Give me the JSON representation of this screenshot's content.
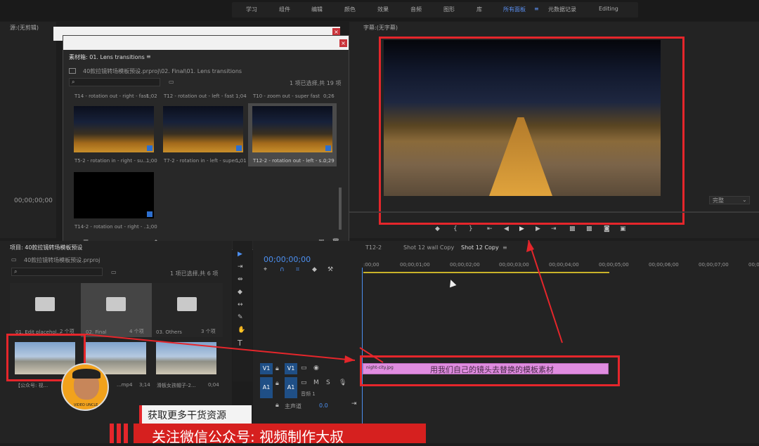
{
  "topbar": {
    "tabs": [
      "学习",
      "组件",
      "编辑",
      "颜色",
      "效果",
      "音频",
      "图形",
      "库",
      "所有面板",
      "元数据记录",
      "Editing"
    ],
    "active_index": 8
  },
  "source_panel": {
    "title": "源:(无剪辑)",
    "timecode": "00;00;00;00"
  },
  "bin_window": {
    "title": "素材箱: 01. Lens transitions",
    "path": "40款拉镜转场模板预设.prproj\\02. Final\\01. Lens transitions",
    "selection": "1 项已选择,共 19 项",
    "row_clips": [
      {
        "label": "T14 - rotation out - right - fast",
        "dur": "1;02"
      },
      {
        "label": "T12 - rotation out - left - fast",
        "dur": "1;04"
      },
      {
        "label": "T10 - zoom out - super fast",
        "dur": "0;26"
      }
    ],
    "clips": [
      {
        "label": "T5-2 - rotation in - right - su...",
        "dur": "1;00"
      },
      {
        "label": "T7-2 - rotation in - left - super...",
        "dur": "1;01"
      },
      {
        "label": "T12-2 - rotation out - left - s...",
        "dur": "0;29"
      },
      {
        "label": "T14-2 - rotation out - right - ...",
        "dur": "1;00"
      }
    ]
  },
  "program": {
    "title": "字幕:(无字幕)",
    "fit": "完整"
  },
  "project": {
    "title": "项目: 40款拉镜转场模板预设",
    "file": "40款拉镜转场模板预设.prproj",
    "selection": "1 项已选择,共 6 项",
    "folders": [
      {
        "label": "01. Edit placehol...",
        "count": "2 个项"
      },
      {
        "label": "02. Final",
        "count": "4 个项"
      },
      {
        "label": "03. Others",
        "count": "3 个项"
      }
    ],
    "clips": [
      {
        "label": "【公众号: 视...",
        "dur": ""
      },
      {
        "label": "...mp4",
        "dur": "3;14"
      },
      {
        "label": "滑板女孩帽子-2...",
        "dur": "0;04"
      }
    ]
  },
  "timeline": {
    "tabs": [
      "T12-2",
      "Shot 12 wall Copy",
      "Shot 12 Copy"
    ],
    "timecode": "00;00;00;00",
    "ruler": [
      ":00;00",
      "00;00;01;00",
      "00;00;02;00",
      "00;00;03;00",
      "00;00;04;00",
      "00;00;05;00",
      "00;00;06;00",
      "00;00;07;00",
      "00;0"
    ],
    "v1": "V1",
    "a1": "A1",
    "audio_label": "音频 1",
    "master": "主声道",
    "master_val": "0.0",
    "clip_name": "night-city.jpg",
    "clip_annotation": "用我们自己的镜头去替换的模板素材"
  },
  "overlay": {
    "banner1": "获取更多干货资源",
    "banner2": "关注微信公众号: 视频制作大叔",
    "avatar_text": "VIDEO UNCLE"
  },
  "colors": {
    "accent": "#e5262b",
    "clip": "#e08ce0",
    "blue": "#2d6fcf"
  }
}
